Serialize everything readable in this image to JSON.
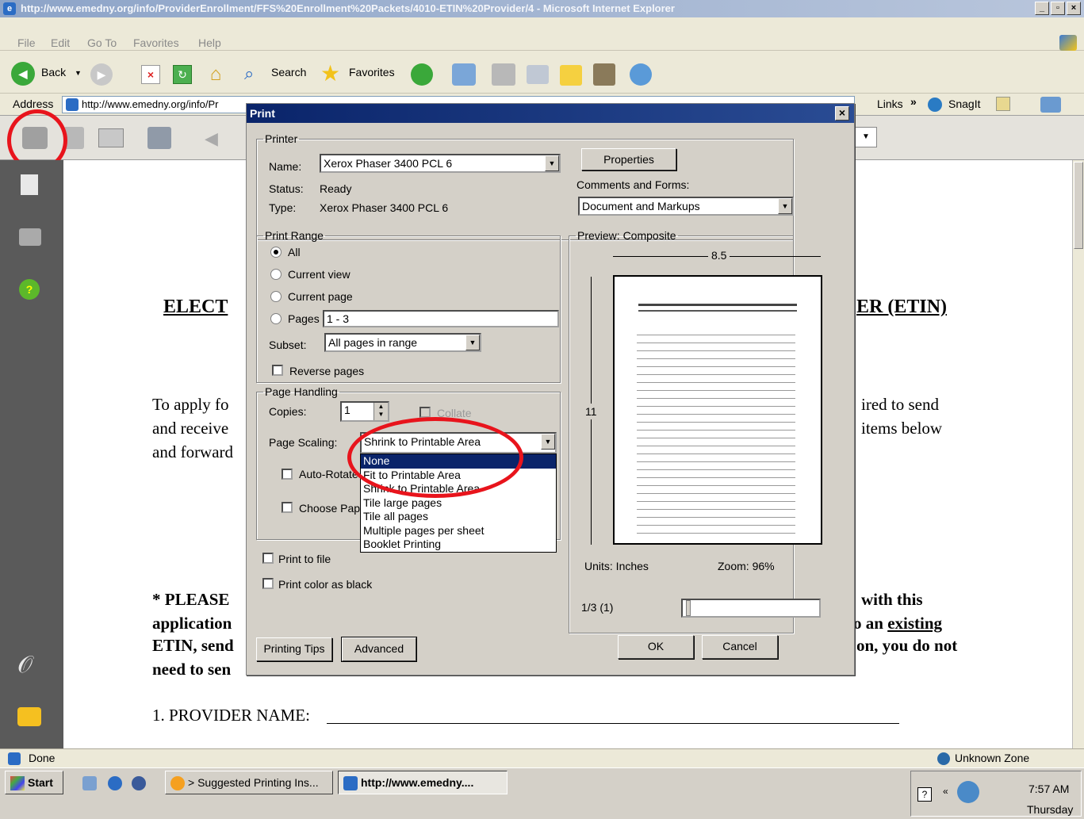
{
  "window": {
    "title": "http://www.emedny.org/info/ProviderEnrollment/FFS%20Enrollment%20Packets/4010-ETIN%20Provider/4 - Microsoft Internet Explorer"
  },
  "menu": [
    "File",
    "Edit",
    "Go To",
    "Favorites",
    "Help"
  ],
  "toolbar": {
    "back": "Back",
    "search": "Search",
    "favorites": "Favorites"
  },
  "address": {
    "label": "Address",
    "value": "http://www.emedny.org/info/Pr",
    "links": "Links",
    "snagit": "SnagIt"
  },
  "document": {
    "heading_left": "ELECT",
    "heading_right": "ER (ETIN)",
    "para_left": [
      "To apply fo",
      "and receive",
      "and forward"
    ],
    "para_right": [
      "ired to send",
      "items below"
    ],
    "note_left": [
      "* PLEASE",
      "application",
      "ETIN, send",
      "need to sen"
    ],
    "note_right_1": "with this",
    "note_right_2_pre": "o an ",
    "note_right_2_link": "existing",
    "note_right_3": "on, you do not",
    "provider_line": "1. PROVIDER NAME:"
  },
  "dialog": {
    "title": "Print",
    "printer": {
      "legend": "Printer",
      "name_label": "Name:",
      "name_value": "Xerox Phaser 3400 PCL 6",
      "status_label": "Status:",
      "status_value": "Ready",
      "type_label": "Type:",
      "type_value": "Xerox Phaser 3400 PCL 6",
      "properties": "Properties",
      "comments_label": "Comments and Forms:",
      "comments_value": "Document and Markups"
    },
    "range": {
      "legend": "Print Range",
      "all": "All",
      "current_view": "Current view",
      "current_page": "Current page",
      "pages": "Pages",
      "pages_value": "1 - 3",
      "subset_label": "Subset:",
      "subset_value": "All pages in range",
      "reverse": "Reverse pages"
    },
    "handling": {
      "legend": "Page Handling",
      "copies_label": "Copies:",
      "copies_value": "1",
      "collate": "Collate",
      "scaling_label": "Page Scaling:",
      "scaling_value": "Shrink to Printable Area",
      "auto_rotate": "Auto-Rotate",
      "choose_paper": "Choose Pap",
      "options": [
        "None",
        "Fit to Printable Area",
        "Shrink to Printable Area",
        "Tile large pages",
        "Tile all pages",
        "Multiple pages per sheet",
        "Booklet Printing"
      ]
    },
    "print_to_file": "Print to file",
    "print_color_black": "Print color as black",
    "preview": {
      "legend": "Preview: Composite",
      "width": "8.5",
      "height": "11",
      "units": "Units: Inches",
      "zoom": "Zoom:  96%",
      "page": "1/3 (1)"
    },
    "buttons": {
      "tips": "Printing Tips",
      "advanced": "Advanced",
      "ok": "OK",
      "cancel": "Cancel"
    }
  },
  "status": {
    "text": "Done",
    "zone": "Unknown Zone"
  },
  "taskbar": {
    "start": "Start",
    "task1": "> Suggested Printing Ins...",
    "task2": "http://www.emedny....",
    "time": "7:57 AM",
    "day": "Thursday"
  }
}
